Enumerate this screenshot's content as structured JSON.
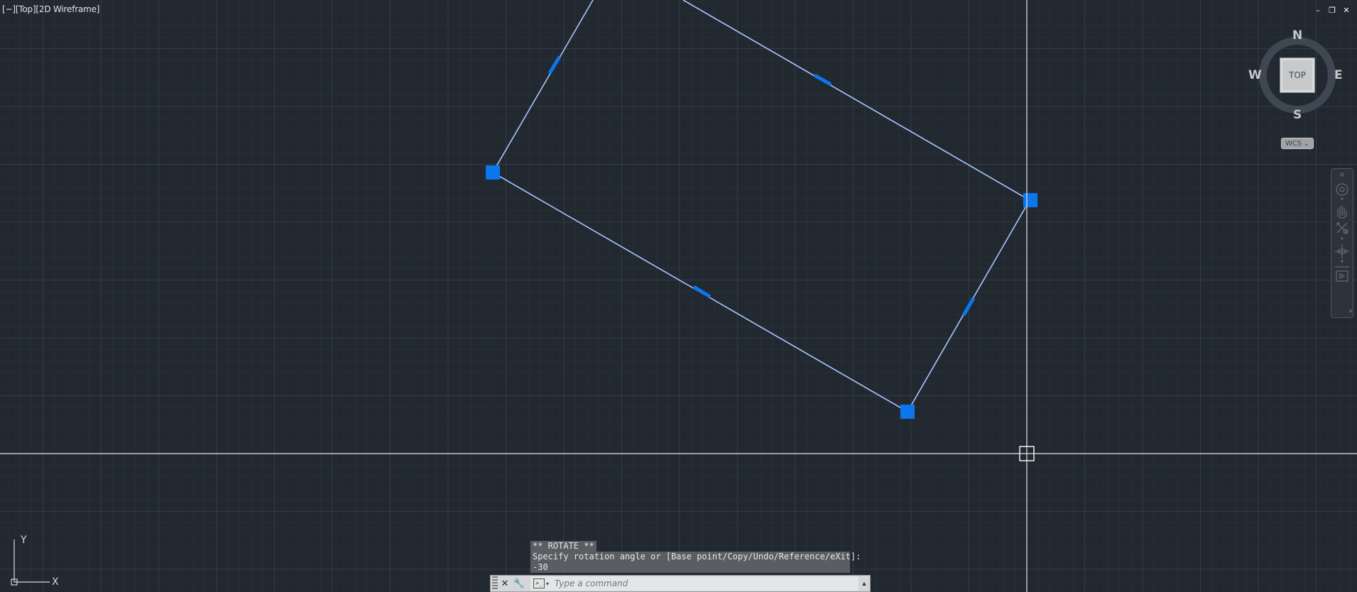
{
  "viewport": {
    "label": "[−][Top][2D Wireframe]",
    "controls": {
      "minimize": "–",
      "restore": "❐",
      "close": "✕"
    }
  },
  "viewcube": {
    "north": "N",
    "south": "S",
    "east": "E",
    "west": "W",
    "face": "TOP"
  },
  "wcs": {
    "label": "WCS",
    "arrow": "⌄"
  },
  "ucs": {
    "x_label": "X",
    "y_label": "Y"
  },
  "command": {
    "history": [
      "** ROTATE **",
      "Specify rotation angle or [Base point/Copy/Undo/Reference/eXit]:",
      "-30"
    ],
    "placeholder": "Type a command"
  },
  "colors": {
    "background": "#212830",
    "grip": "#0a77ef",
    "selected_line": "#a9c8ff"
  }
}
